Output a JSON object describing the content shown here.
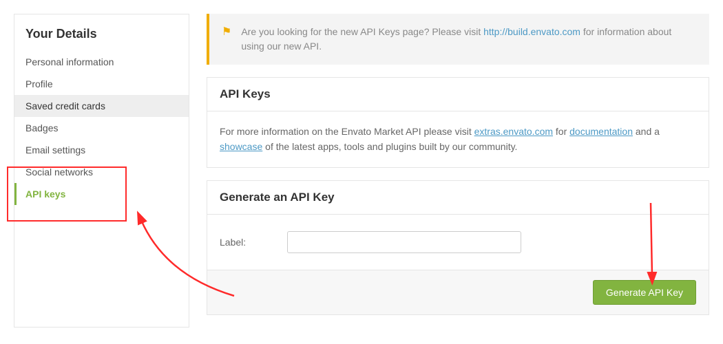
{
  "sidebar": {
    "header": "Your Details",
    "items": [
      {
        "label": "Personal information"
      },
      {
        "label": "Profile"
      },
      {
        "label": "Saved credit cards"
      },
      {
        "label": "Badges"
      },
      {
        "label": "Email settings"
      },
      {
        "label": "Social networks"
      },
      {
        "label": "API keys"
      }
    ]
  },
  "notice": {
    "pre": "Are you looking for the new API Keys page? Please visit ",
    "link_text": "http://build.envato.com",
    "post": " for information about using our new API."
  },
  "api_keys_panel": {
    "title": "API Keys",
    "body_pre": "For more information on the Envato Market API please visit ",
    "link1": "extras.envato.com",
    "body_mid1": " for ",
    "link2": "documentation",
    "body_mid2": " and a ",
    "link3": "showcase",
    "body_post": " of the latest apps, tools and plugins built by our community."
  },
  "generate_panel": {
    "title": "Generate an API Key",
    "label": "Label:",
    "input_value": "",
    "button": "Generate API Key"
  }
}
